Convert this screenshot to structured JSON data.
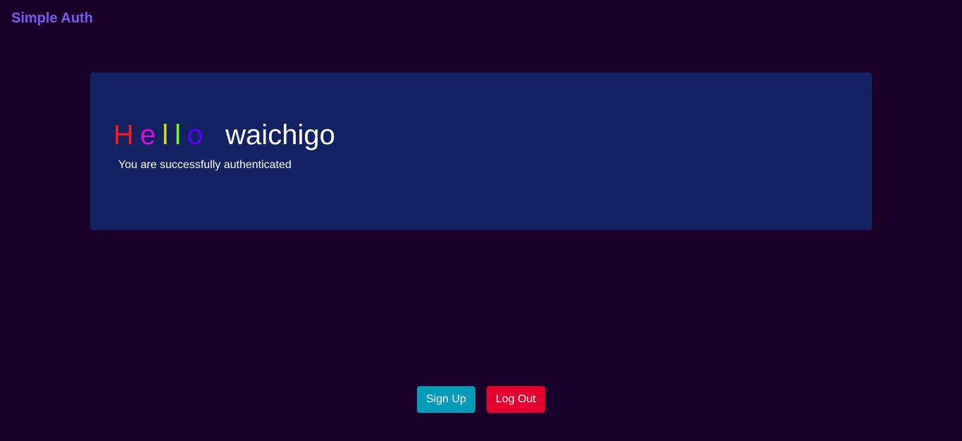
{
  "header": {
    "brand": "Simple Auth",
    "brand_color": "#7a5af5"
  },
  "card": {
    "greeting_letters": [
      {
        "char": "H",
        "color": "#ff1a1a"
      },
      {
        "char": "e",
        "color": "#d40fd4"
      },
      {
        "char": "l",
        "color": "#e0e000"
      },
      {
        "char": "l",
        "color": "#7cfc00"
      },
      {
        "char": "o",
        "color": "#5a00ff"
      }
    ],
    "username": "waichigo",
    "message": "You are successfully authenticated",
    "background": "#122262"
  },
  "actions": {
    "signup_label": "Sign Up",
    "signup_color": "#009cb8",
    "logout_label": "Log Out",
    "logout_color": "#e6002e"
  },
  "page_background": "#1b0029"
}
